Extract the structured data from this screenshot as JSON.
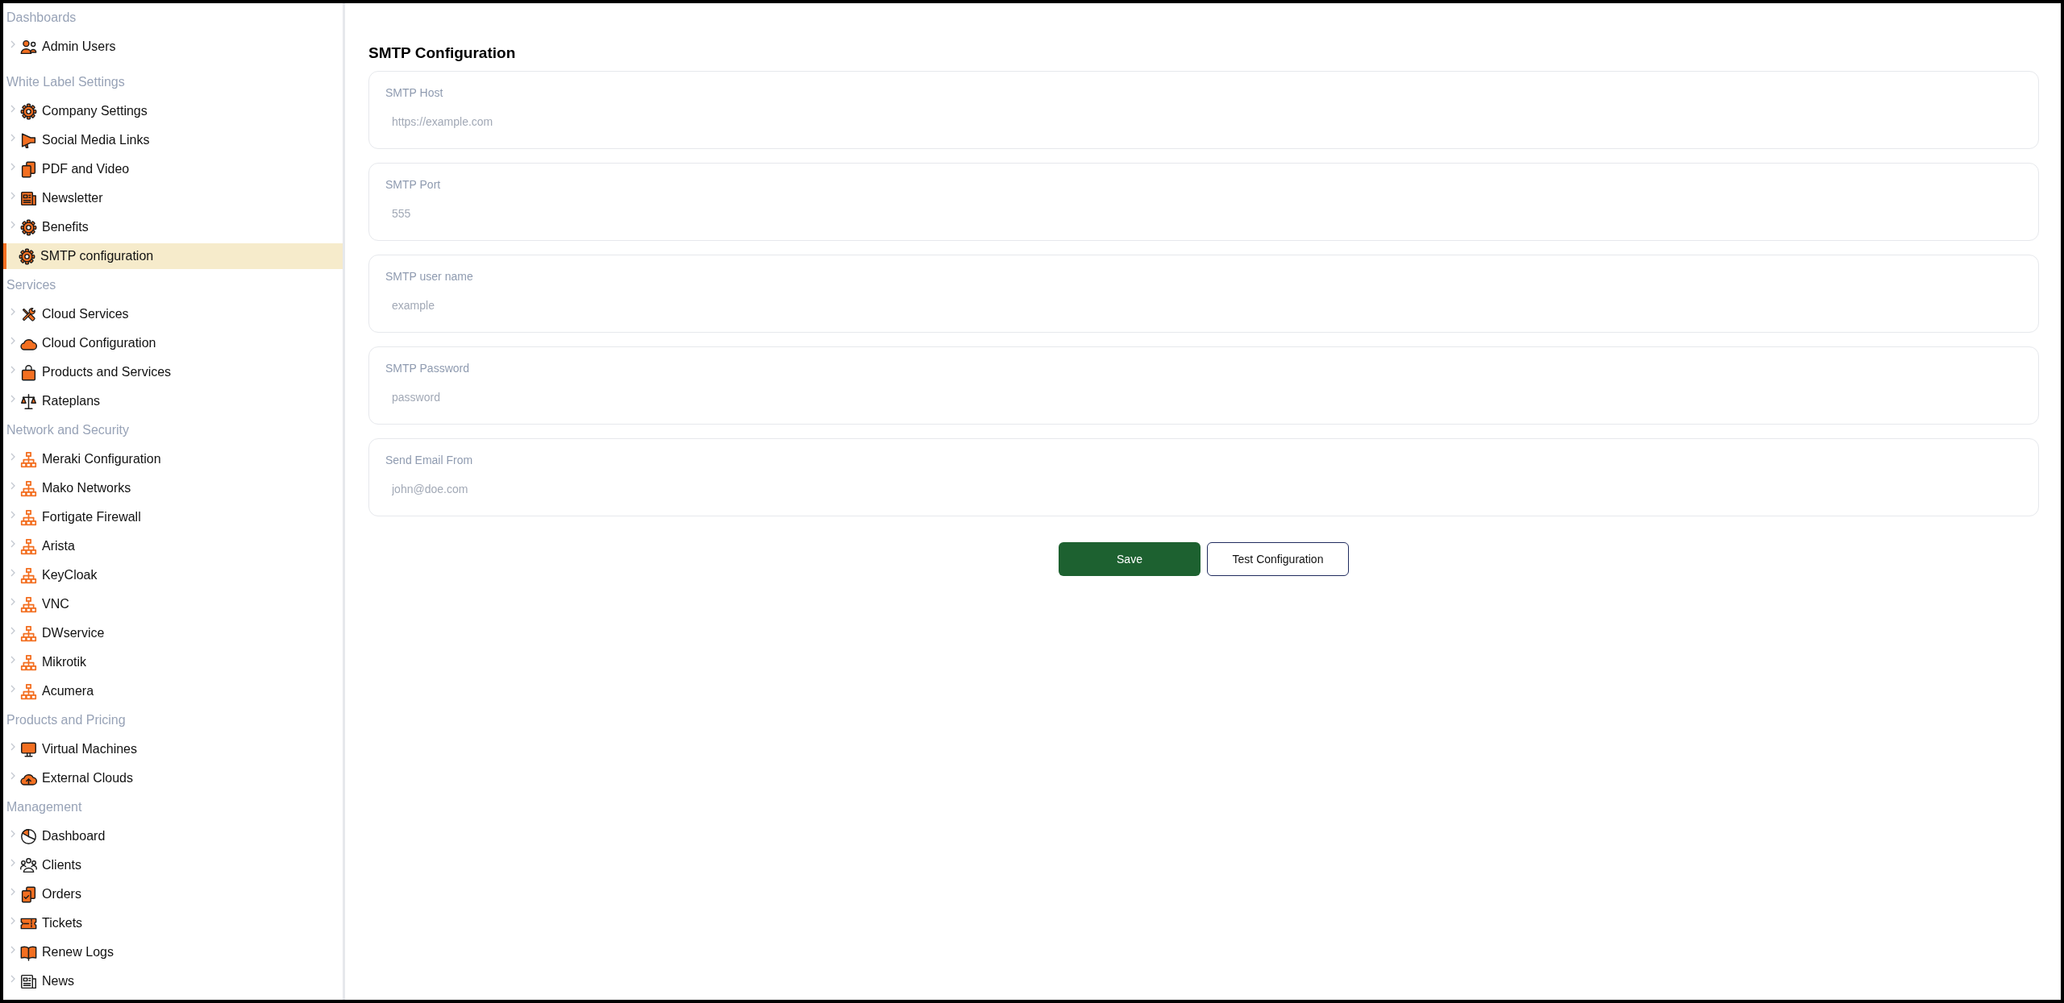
{
  "sidebar": {
    "groups": [
      {
        "title": "Dashboards",
        "items": [
          {
            "label": "Admin Users",
            "selected": false
          }
        ]
      },
      {
        "title": "White Label Settings",
        "items": [
          {
            "label": "Company Settings",
            "selected": false
          },
          {
            "label": "Social Media Links",
            "selected": false
          },
          {
            "label": "PDF and Video",
            "selected": false
          },
          {
            "label": "Newsletter",
            "selected": false
          },
          {
            "label": "Benefits",
            "selected": false
          },
          {
            "label": "SMTP configuration",
            "selected": true
          }
        ]
      },
      {
        "title": "Services",
        "items": [
          {
            "label": "Cloud Services",
            "selected": false
          },
          {
            "label": "Cloud Configuration",
            "selected": false
          },
          {
            "label": "Products and Services",
            "selected": false
          },
          {
            "label": "Rateplans",
            "selected": false
          }
        ]
      },
      {
        "title": "Network and Security",
        "items": [
          {
            "label": "Meraki Configuration",
            "selected": false
          },
          {
            "label": "Mako Networks",
            "selected": false
          },
          {
            "label": "Fortigate Firewall",
            "selected": false
          },
          {
            "label": "Arista",
            "selected": false
          },
          {
            "label": "KeyCloak",
            "selected": false
          },
          {
            "label": "VNC",
            "selected": false
          },
          {
            "label": "DWservice",
            "selected": false
          },
          {
            "label": "Mikrotik",
            "selected": false
          },
          {
            "label": "Acumera",
            "selected": false
          }
        ]
      },
      {
        "title": "Products and Pricing",
        "items": [
          {
            "label": "Virtual Machines",
            "selected": false
          },
          {
            "label": "External Clouds",
            "selected": false
          }
        ]
      },
      {
        "title": "Management",
        "items": [
          {
            "label": "Dashboard",
            "selected": false
          },
          {
            "label": "Clients",
            "selected": false
          },
          {
            "label": "Orders",
            "selected": false
          },
          {
            "label": "Tickets",
            "selected": false
          },
          {
            "label": "Renew Logs",
            "selected": false
          },
          {
            "label": "News",
            "selected": false
          }
        ]
      }
    ]
  },
  "form": {
    "title": "SMTP Configuration",
    "fields": [
      {
        "label": "SMTP Host",
        "placeholder": "https://example.com"
      },
      {
        "label": "SMTP Port",
        "placeholder": "555"
      },
      {
        "label": "SMTP user name",
        "placeholder": "example"
      },
      {
        "label": "SMTP Password",
        "placeholder": "password"
      },
      {
        "label": "Send Email From",
        "placeholder": "john@doe.com"
      }
    ],
    "buttons": [
      {
        "label": "Save",
        "kind": "primary"
      },
      {
        "label": "Test Configuration",
        "kind": "outline"
      }
    ]
  }
}
